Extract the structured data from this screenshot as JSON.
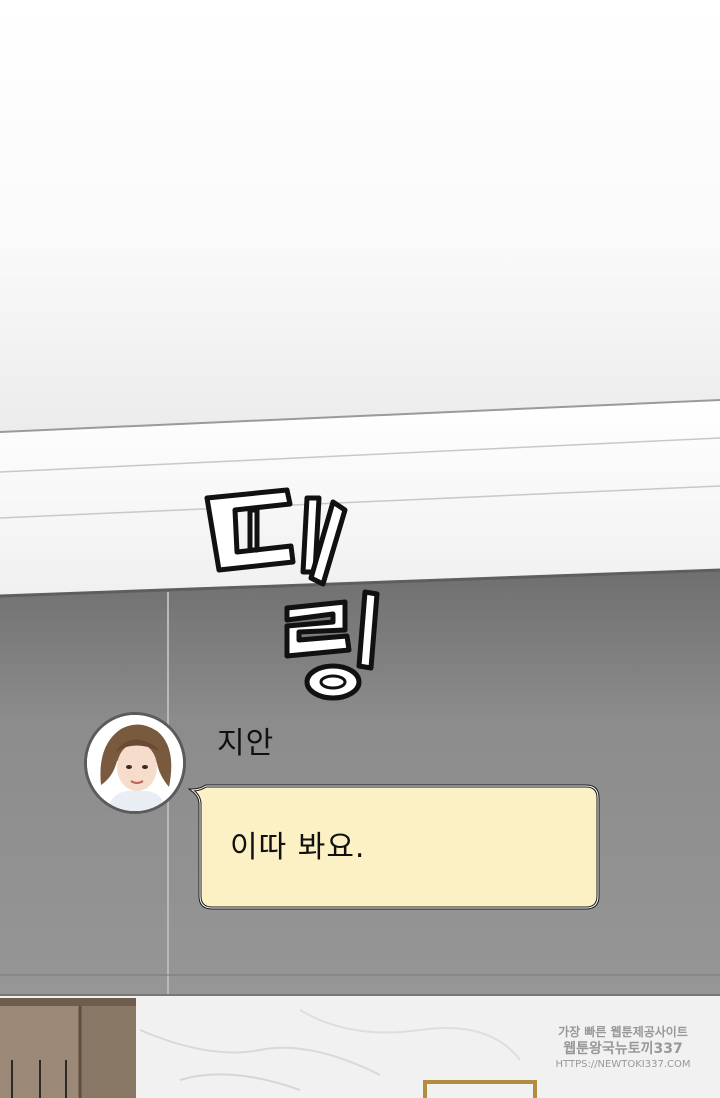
{
  "sfx": {
    "text": "띠링"
  },
  "message": {
    "sender": "지안",
    "text": "이따 봐요."
  },
  "watermark": {
    "line1": "가장 빠른 웹툰제공사이트",
    "line2": "웹툰왕국뉴토끼337",
    "line3": "HTTPS://NEWTOKI337.COM"
  },
  "colors": {
    "bubble_fill": "#fcf1c4",
    "wall": "#8a8a8a",
    "ceiling": "#f4f4f4"
  }
}
